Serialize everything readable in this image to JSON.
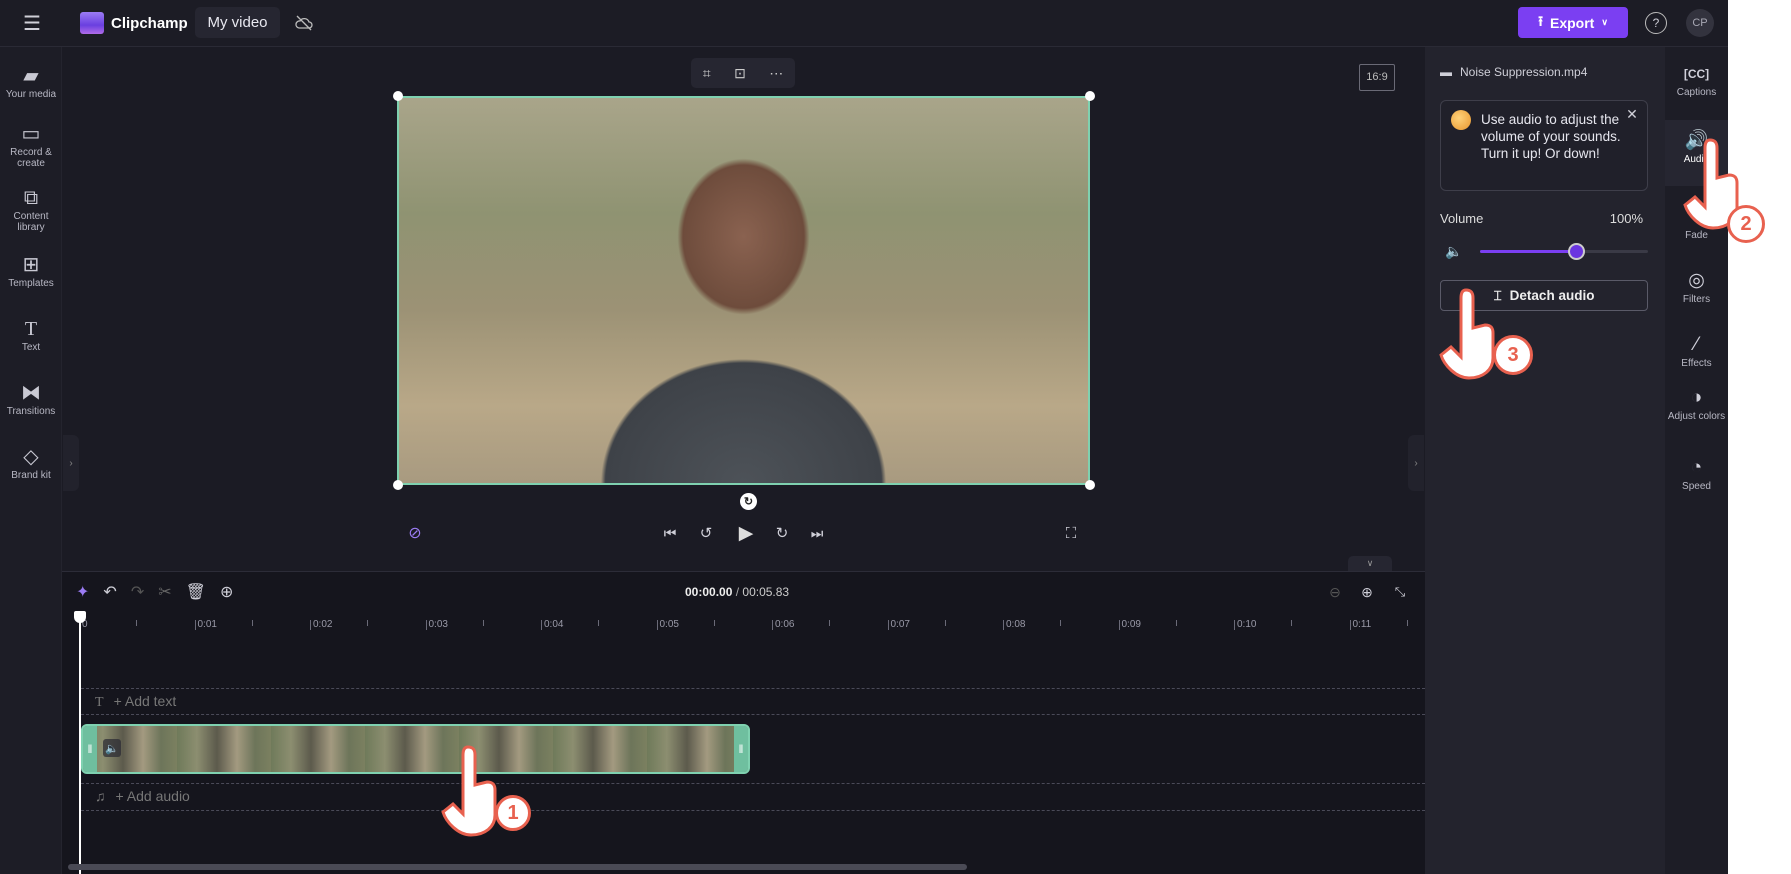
{
  "app": {
    "name": "Clipchamp",
    "project_title": "My video",
    "export_label": "Export",
    "avatar_initials": "CP",
    "accent": "#7b3ff2",
    "selection": "#7fd1b0"
  },
  "sidebar": {
    "items": [
      {
        "label": "Your media",
        "icon": "folder-icon"
      },
      {
        "label": "Record & create",
        "icon": "camera-icon"
      },
      {
        "label": "Content library",
        "icon": "library-icon"
      },
      {
        "label": "Templates",
        "icon": "templates-icon"
      },
      {
        "label": "Text",
        "icon": "text-icon"
      },
      {
        "label": "Transitions",
        "icon": "transitions-icon"
      },
      {
        "label": "Brand kit",
        "icon": "brand-kit-icon"
      }
    ]
  },
  "preview": {
    "aspect_ratio": "16:9"
  },
  "timeline": {
    "current_time": "00:00.00",
    "separator": " / ",
    "total_time": "00:05.83",
    "ticks": [
      "0",
      "0:01",
      "0:02",
      "0:03",
      "0:04",
      "0:05",
      "0:06",
      "0:07",
      "0:08",
      "0:09",
      "0:10",
      "0:11"
    ],
    "add_text": "+ Add text",
    "add_audio": "+ Add audio"
  },
  "properties": {
    "filename": "Noise Suppression.mp4",
    "tip": "Use audio to adjust the volume of your sounds. Turn it up! Or down!",
    "volume_label": "Volume",
    "volume_value": "100%",
    "slider_level": 0.57,
    "detach_label": "Detach audio"
  },
  "rail": {
    "items": [
      {
        "label": "Captions"
      },
      {
        "label": "Audio"
      },
      {
        "label": "Fade"
      },
      {
        "label": "Filters"
      },
      {
        "label": "Effects"
      },
      {
        "label": "Adjust colors"
      },
      {
        "label": "Speed"
      }
    ]
  },
  "annotations": {
    "step1": "1",
    "step2": "2",
    "step3": "3"
  }
}
